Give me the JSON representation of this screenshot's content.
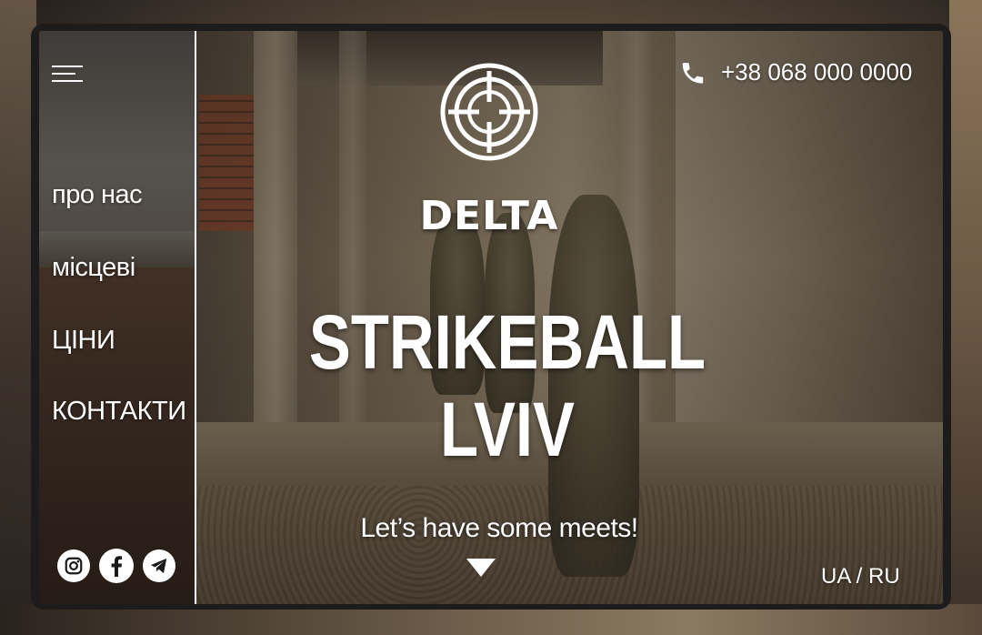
{
  "brand": {
    "logo_text": "DELTA",
    "logo_icon": "crosshair-target-icon"
  },
  "menu": {
    "icon": "hamburger-menu-icon",
    "items": [
      {
        "label": "про нас"
      },
      {
        "label": "місцеві"
      },
      {
        "label": "ЦІНИ"
      },
      {
        "label": "КОНТАКТИ"
      }
    ]
  },
  "hero": {
    "title_line1": "STRIKEBALL",
    "title_line2": "LVIV",
    "tagline": "Let’s have some meets!",
    "scroll_icon": "down-triangle-icon"
  },
  "contact": {
    "phone": "+38 068 000 0000",
    "phone_icon": "phone-icon"
  },
  "language": {
    "label": "UA / RU"
  },
  "socials": [
    {
      "name": "instagram-icon"
    },
    {
      "name": "facebook-icon"
    },
    {
      "name": "telegram-icon"
    }
  ],
  "colors": {
    "text": "#ffffff",
    "frame": "#1c1c1c",
    "overlay": "#4b4236"
  }
}
